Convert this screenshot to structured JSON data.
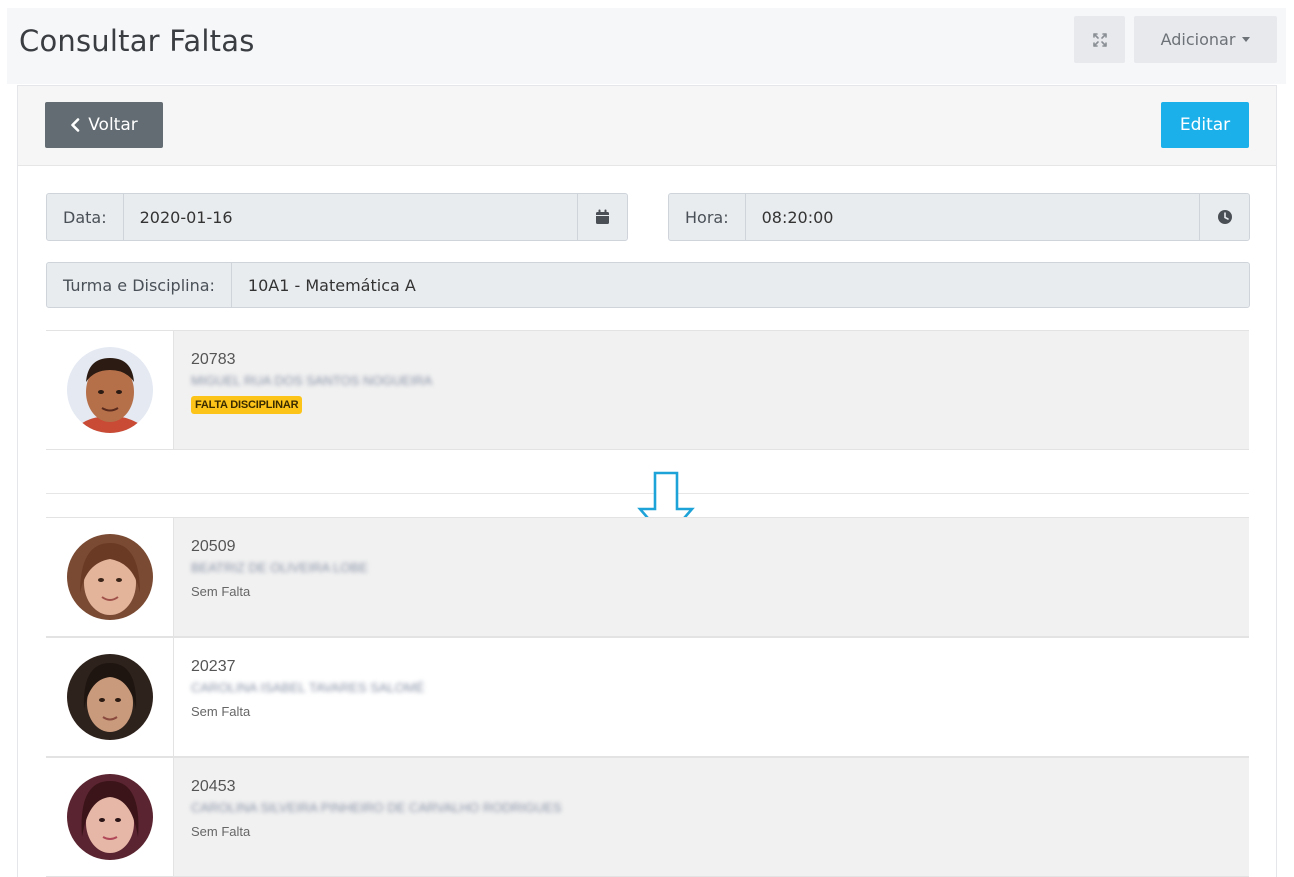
{
  "header": {
    "title": "Consultar Faltas",
    "add_label": "Adicionar",
    "expand_icon": "expand-icon"
  },
  "toolbar": {
    "back_label": "Voltar",
    "edit_label": "Editar"
  },
  "filters": {
    "date_label": "Data:",
    "date_value": "2020-01-16",
    "time_label": "Hora:",
    "time_value": "08:20:00",
    "class_label": "Turma e Disciplina:",
    "class_value": "10A1 - Matemática A"
  },
  "students": [
    {
      "number": "20783",
      "name": "MIGUEL RUA DOS SANTOS NOGUEIRA",
      "status": "FALTA DISCIPLINAR",
      "status_type": "badge"
    },
    {
      "number": "20509",
      "name": "BEATRIZ DE OLIVEIRA LOBE",
      "status": "Sem Falta",
      "status_type": "text"
    },
    {
      "number": "20237",
      "name": "CAROLINA ISABEL TAVARES SALOMÉ",
      "status": "Sem Falta",
      "status_type": "text"
    },
    {
      "number": "20453",
      "name": "CAROLINA SILVEIRA PINHEIRO DE CARVALHO RODRIGUES",
      "status": "Sem Falta",
      "status_type": "text"
    }
  ],
  "colors": {
    "primary": "#1cb0eb",
    "secondary": "#636c72",
    "warning": "#fcc419",
    "arrow": "#1ea3d8"
  }
}
